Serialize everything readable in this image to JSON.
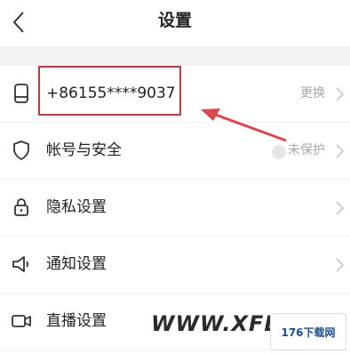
{
  "header": {
    "title": "设置"
  },
  "rows": [
    {
      "label": "+86155****9037",
      "right": "更换"
    },
    {
      "label": "帐号与安全",
      "right": "未保护"
    },
    {
      "label": "隐私设置",
      "right": ""
    },
    {
      "label": "通知设置",
      "right": ""
    },
    {
      "label": "直播设置",
      "right": ""
    }
  ],
  "watermark": {
    "text": "WWW.XFDOW",
    "logo": "176下载网"
  },
  "colors": {
    "highlight": "#b53c43",
    "arrow": "#d84a52"
  },
  "icons": [
    "phone-icon",
    "shield-icon",
    "lock-icon",
    "speaker-icon",
    "video-camera-icon"
  ]
}
